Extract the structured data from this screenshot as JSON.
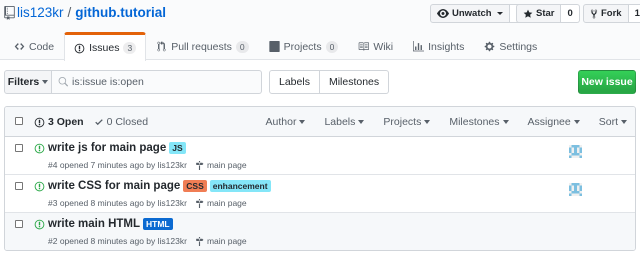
{
  "repo": {
    "owner": "lis123kr",
    "separator": "/",
    "name": "github.tutorial"
  },
  "actions": [
    {
      "label": "Unwatch",
      "count": "1",
      "icon": "eye-icon",
      "has_caret": true
    },
    {
      "label": "Star",
      "count": "0",
      "icon": "star-icon",
      "has_caret": false
    },
    {
      "label": "Fork",
      "count": "1",
      "icon": "fork-icon",
      "has_caret": false
    }
  ],
  "tabs": [
    {
      "label": "Code",
      "icon": "code-icon",
      "counter": ""
    },
    {
      "label": "Issues",
      "icon": "issue-opened-icon",
      "counter": "3",
      "selected": true
    },
    {
      "label": "Pull requests",
      "icon": "pull-request-icon",
      "counter": "0"
    },
    {
      "label": "Projects",
      "icon": "project-icon",
      "counter": "0"
    },
    {
      "label": "Wiki",
      "icon": "book-icon",
      "counter": ""
    },
    {
      "label": "Insights",
      "icon": "graph-icon",
      "counter": ""
    },
    {
      "label": "Settings",
      "icon": "gear-icon",
      "counter": ""
    }
  ],
  "toolbar": {
    "filters_label": "Filters",
    "search_value": "is:issue is:open",
    "labels_label": "Labels",
    "milestones_label": "Milestones",
    "new_issue_label": "New issue"
  },
  "list_header": {
    "open_label": "3 Open",
    "closed_label": "0 Closed",
    "filters": [
      "Author",
      "Labels",
      "Projects",
      "Milestones",
      "Assignee",
      "Sort"
    ]
  },
  "issues": [
    {
      "title": "write js for main page",
      "labels": [
        {
          "name": "JS",
          "bg": "#84e6f8",
          "fg": "#24292e"
        }
      ],
      "meta": "#4 opened 7 minutes ago by lis123kr",
      "milestone": "main page",
      "has_assignee": true
    },
    {
      "title": "write CSS for main page",
      "labels": [
        {
          "name": "CSS",
          "bg": "#f07d54",
          "fg": "#24292e"
        },
        {
          "name": "enhancement",
          "bg": "#84e6f8",
          "fg": "#24292e"
        }
      ],
      "meta": "#3 opened 8 minutes ago by lis123kr",
      "milestone": "main page",
      "has_assignee": true
    },
    {
      "title": "write main HTML",
      "labels": [
        {
          "name": "HTML",
          "bg": "#0b6ad1",
          "fg": "#ffffff"
        }
      ],
      "meta": "#2 opened 8 minutes ago by lis123kr",
      "milestone": "main page",
      "has_assignee": false
    }
  ],
  "colors": {
    "link": "#0366d6",
    "open_green": "#28a745",
    "tab_accent": "#e36209"
  }
}
